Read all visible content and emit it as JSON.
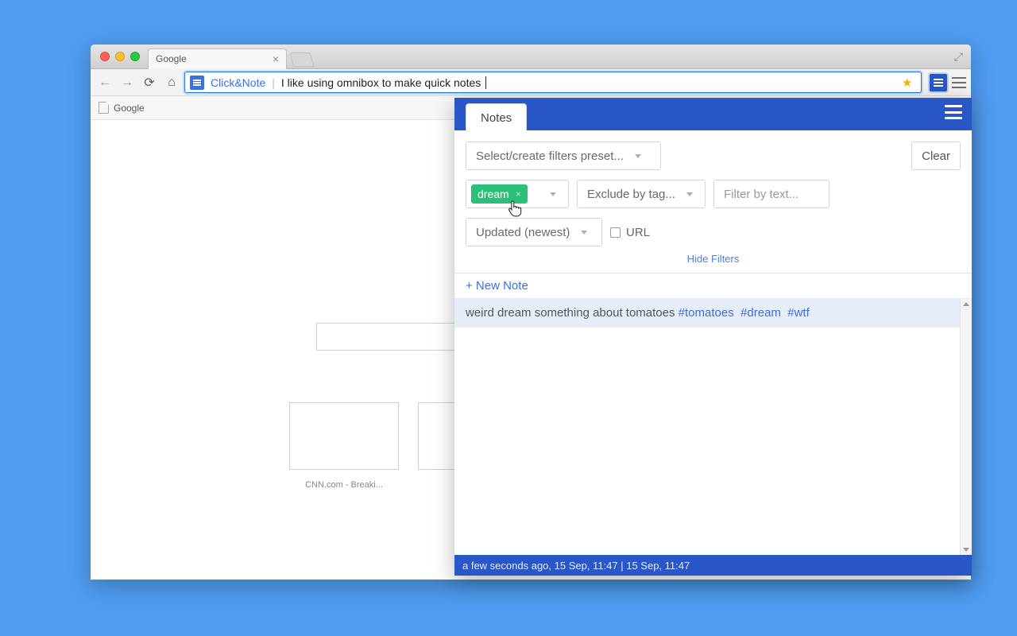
{
  "browser": {
    "tab_title": "Google",
    "omnibox_extension": "Click&Note",
    "omnibox_text": "I like using omnibox to make quick notes",
    "bookmark": "Google"
  },
  "page": {
    "search_placeholder": "",
    "thumb_label": "CNN.com - Breaki..."
  },
  "panel": {
    "tab": "Notes",
    "preset_placeholder": "Select/create filters preset...",
    "clear": "Clear",
    "tag_active": "dream",
    "exclude_placeholder": "Exclude by tag...",
    "filter_text_placeholder": "Filter by text...",
    "sort": "Updated (newest)",
    "url_label": "URL",
    "hide_filters": "Hide Filters",
    "new_note": "+ New Note",
    "note": {
      "text": "weird dream something about tomatoes",
      "tags": [
        "#tomatoes",
        "#dream",
        "#wtf"
      ]
    },
    "status": "a few seconds ago, 15 Sep, 11:47 | 15 Sep, 11:47"
  }
}
